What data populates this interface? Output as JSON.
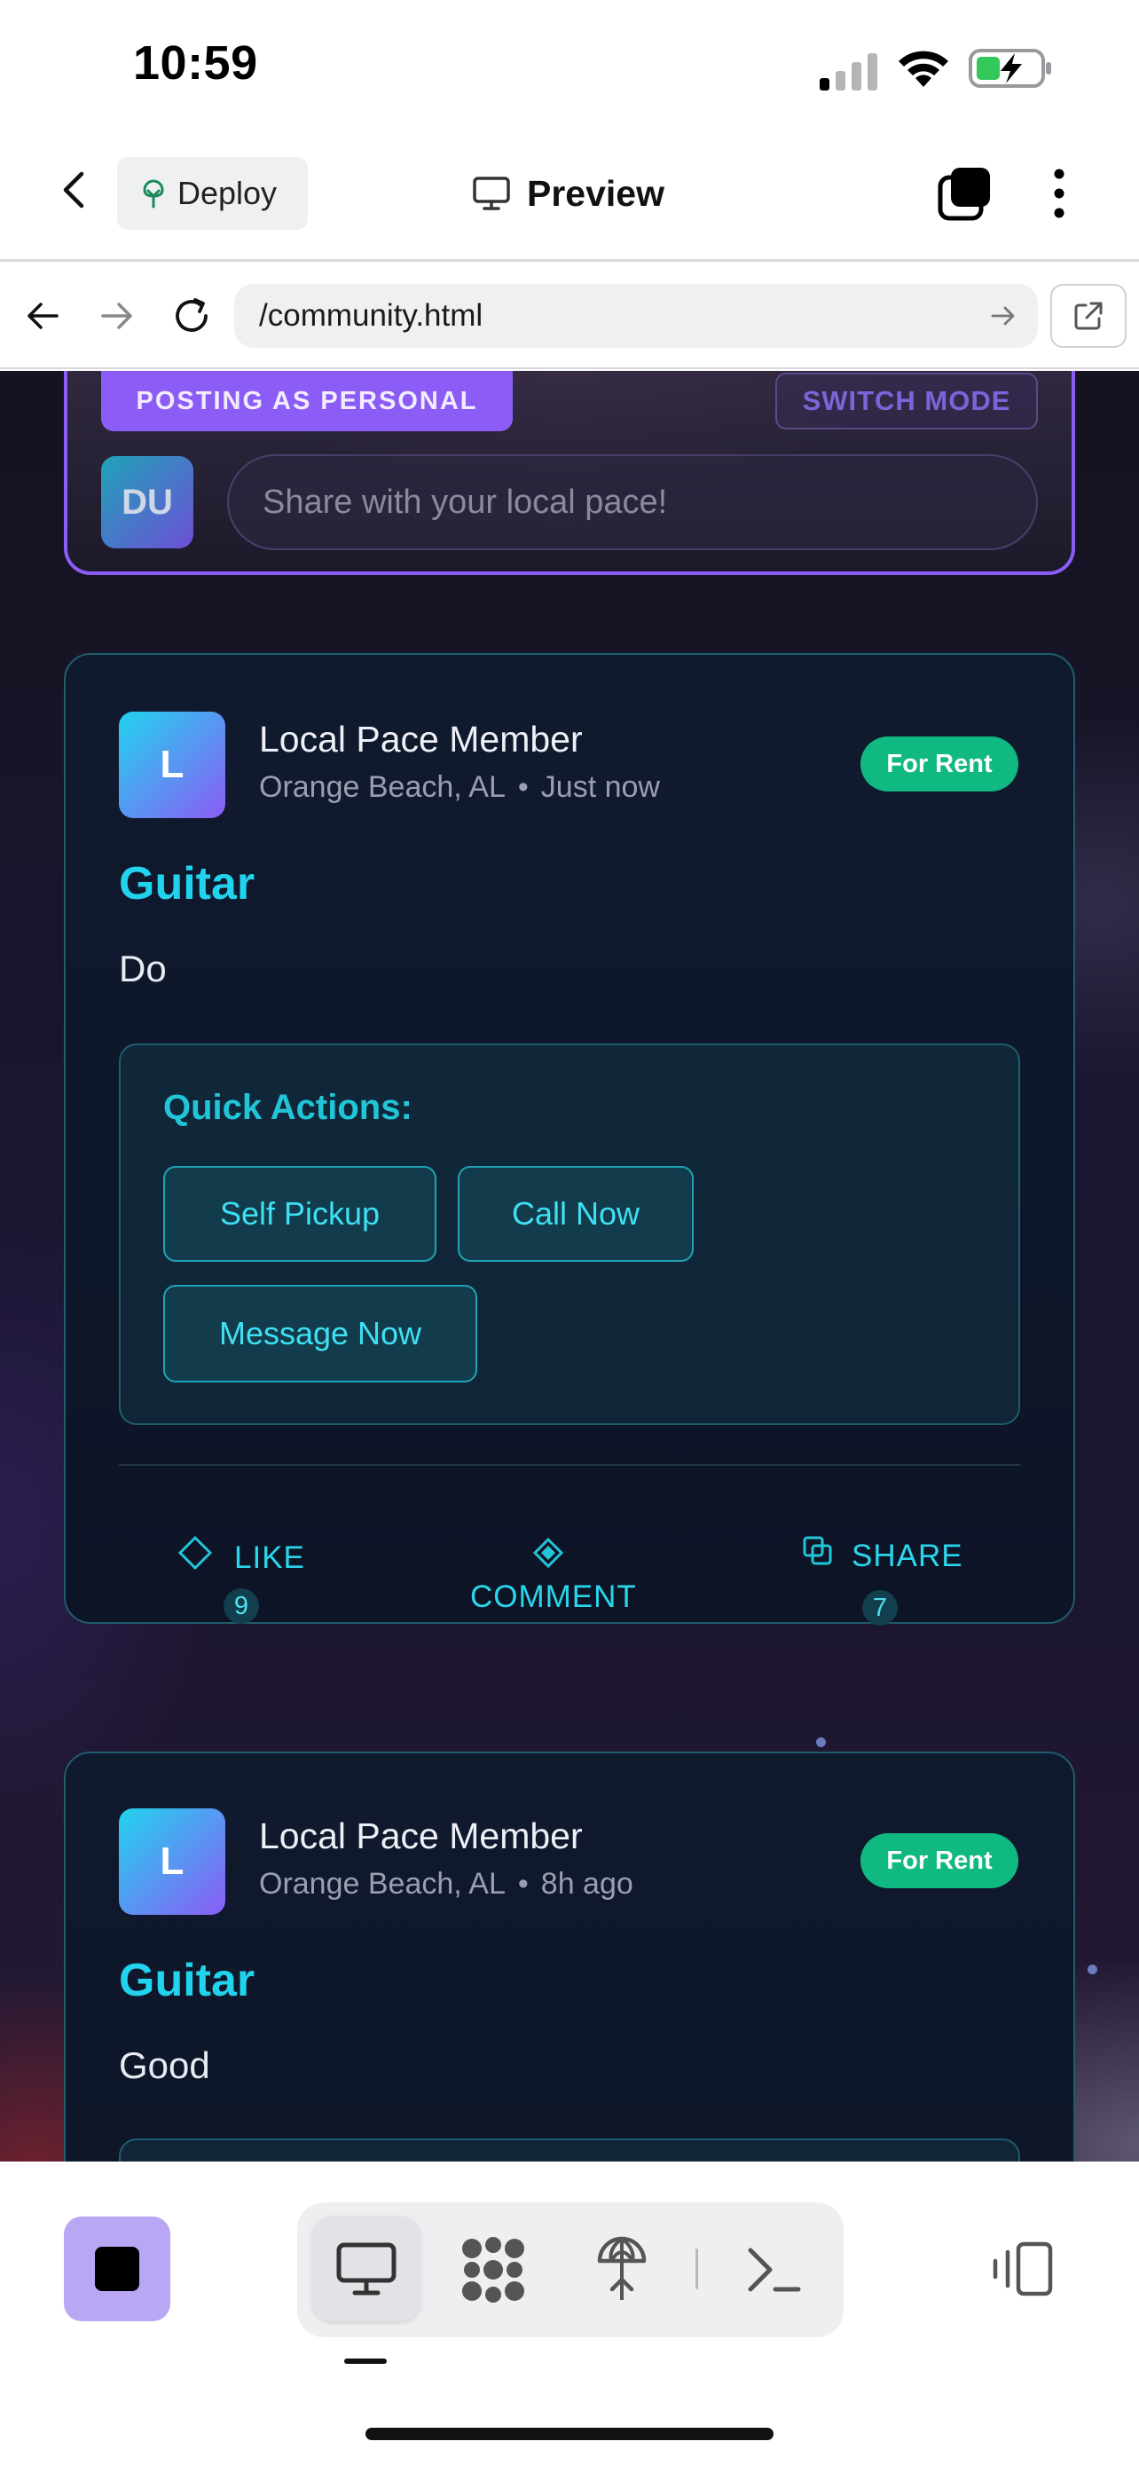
{
  "status_bar": {
    "time": "10:59"
  },
  "app_header": {
    "deploy_label": "Deploy",
    "title": "Preview"
  },
  "browser": {
    "url": "/community.html"
  },
  "composer": {
    "posting_mode": "POSTING AS PERSONAL",
    "switch_label": "SWITCH MODE",
    "avatar_initials": "DU",
    "placeholder": "Share with your local pace!"
  },
  "posts": [
    {
      "avatar_initial": "L",
      "author": "Local Pace Member",
      "location": "Orange Beach, AL",
      "time": "Just now",
      "badge": "For Rent",
      "title": "Guitar",
      "body": "Do",
      "quick_actions_title": "Quick Actions:",
      "quick_actions": [
        "Self Pickup",
        "Call Now",
        "Message Now"
      ],
      "like_label": "LIKE",
      "like_count": "9",
      "comment_label": "COMMENT",
      "share_label": "SHARE",
      "share_count": "7"
    },
    {
      "avatar_initial": "L",
      "author": "Local Pace Member",
      "location": "Orange Beach, AL",
      "time": "8h ago",
      "badge": "For Rent",
      "title": "Guitar",
      "body": "Good"
    }
  ],
  "meta_separator": "•",
  "colors": {
    "accent_cyan": "#22d3ee",
    "accent_purple": "#8b5cf6",
    "badge_green": "#10b981"
  },
  "icons": [
    "back-chevron-icon",
    "deploy-tree-icon",
    "monitor-icon",
    "tabs-icon",
    "more-vertical-icon",
    "arrow-left-icon",
    "arrow-right-icon",
    "reload-icon",
    "go-arrow-icon",
    "open-external-icon",
    "diamond-outline-icon",
    "diamond-filled-icon",
    "share-squares-icon",
    "stop-icon",
    "grid-dots-icon",
    "deploy-icon",
    "terminal-icon",
    "devices-icon"
  ]
}
